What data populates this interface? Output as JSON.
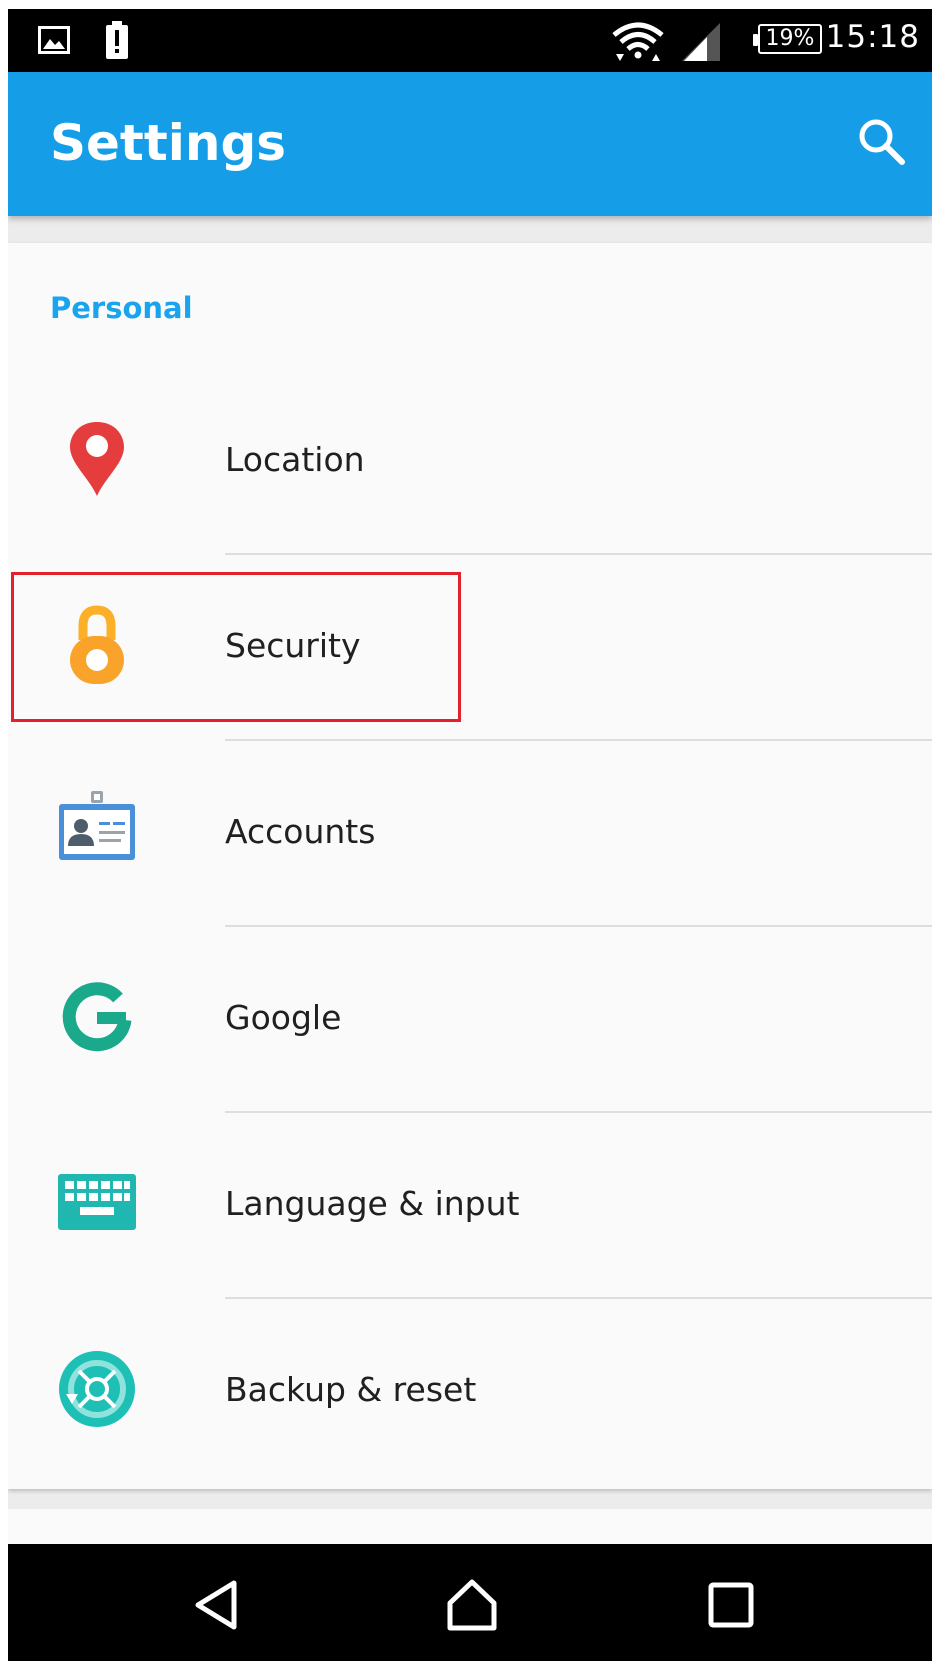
{
  "status_bar": {
    "time": "15:18",
    "battery": "19%",
    "icons": [
      "image-icon",
      "battery-alert-icon",
      "wifi-icon",
      "signal-icon"
    ]
  },
  "app_bar": {
    "title": "Settings",
    "search_icon": "search-icon"
  },
  "section": {
    "header": "Personal"
  },
  "items": [
    {
      "label": "Location",
      "icon": "location-pin-icon"
    },
    {
      "label": "Security",
      "icon": "padlock-icon"
    },
    {
      "label": "Accounts",
      "icon": "id-badge-icon"
    },
    {
      "label": "Google",
      "icon": "google-g-icon"
    },
    {
      "label": "Language & input",
      "icon": "keyboard-icon"
    },
    {
      "label": "Backup & reset",
      "icon": "backup-icon"
    }
  ],
  "nav_bar": {
    "buttons": [
      "back-icon",
      "home-icon",
      "recents-icon"
    ]
  },
  "colors": {
    "app_bar": "#169de8",
    "accent": "#1ba4ee",
    "highlight": "#e3202b"
  }
}
